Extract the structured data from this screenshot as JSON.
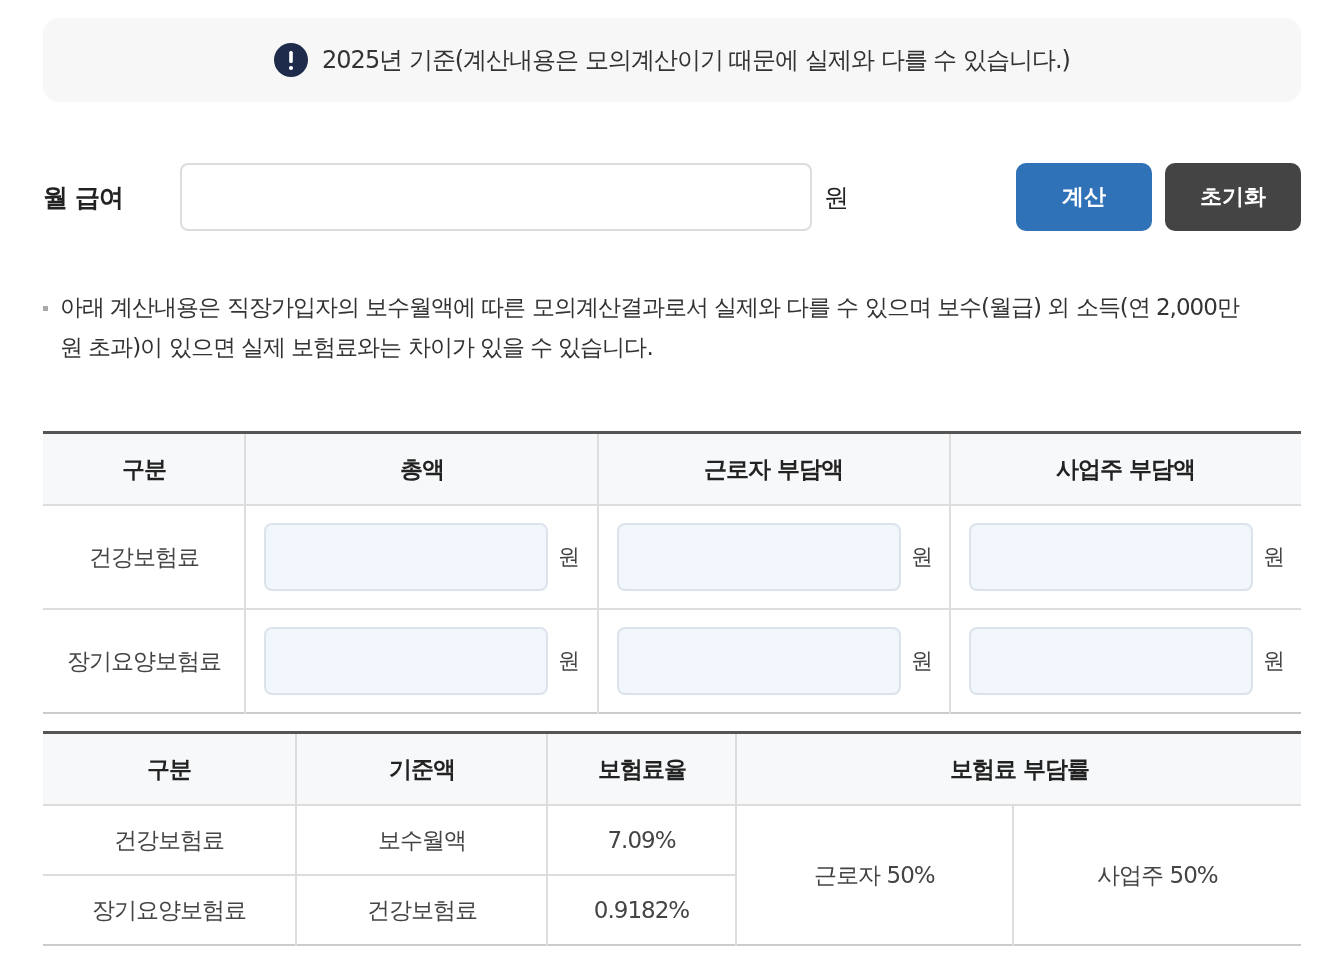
{
  "notice": {
    "text": "2025년 기준(계산내용은 모의계산이기 때문에 실제와 다를 수 있습니다.)"
  },
  "salary": {
    "label": "월 급여",
    "unit": "원",
    "buttons": [
      {
        "label": "계산",
        "kind": "primary"
      },
      {
        "label": "초기화",
        "kind": "secondary"
      }
    ]
  },
  "note": "아래 계산내용은 직장가입자의 보수월액에 따른 모의계산결과로서 실제와 다를 수 있으며 보수(월급) 외 소득(연 2,000만원 초과)이 있으면 실제 보험료와는 차이가 있을 수 있습니다.",
  "result_table": {
    "columns": [
      "구분",
      "총액",
      "근로자 부담액",
      "사업주 부담액"
    ],
    "rows": [
      {
        "label": "건강보험료",
        "units": [
          "원",
          "원",
          "원"
        ]
      },
      {
        "label": "장기요양보험료",
        "units": [
          "원",
          "원",
          "원"
        ]
      }
    ]
  },
  "rate_table": {
    "columns": [
      "구분",
      "기준액",
      "보험료율",
      "보험료 부담률"
    ],
    "rows": [
      {
        "cells": [
          "건강보험료",
          "보수월액",
          "7.09%"
        ]
      },
      {
        "cells": [
          "장기요양보험료",
          "건강보험료",
          "0.9182%"
        ]
      }
    ],
    "shares": [
      "근로자 50%",
      "사업주 50%"
    ]
  }
}
